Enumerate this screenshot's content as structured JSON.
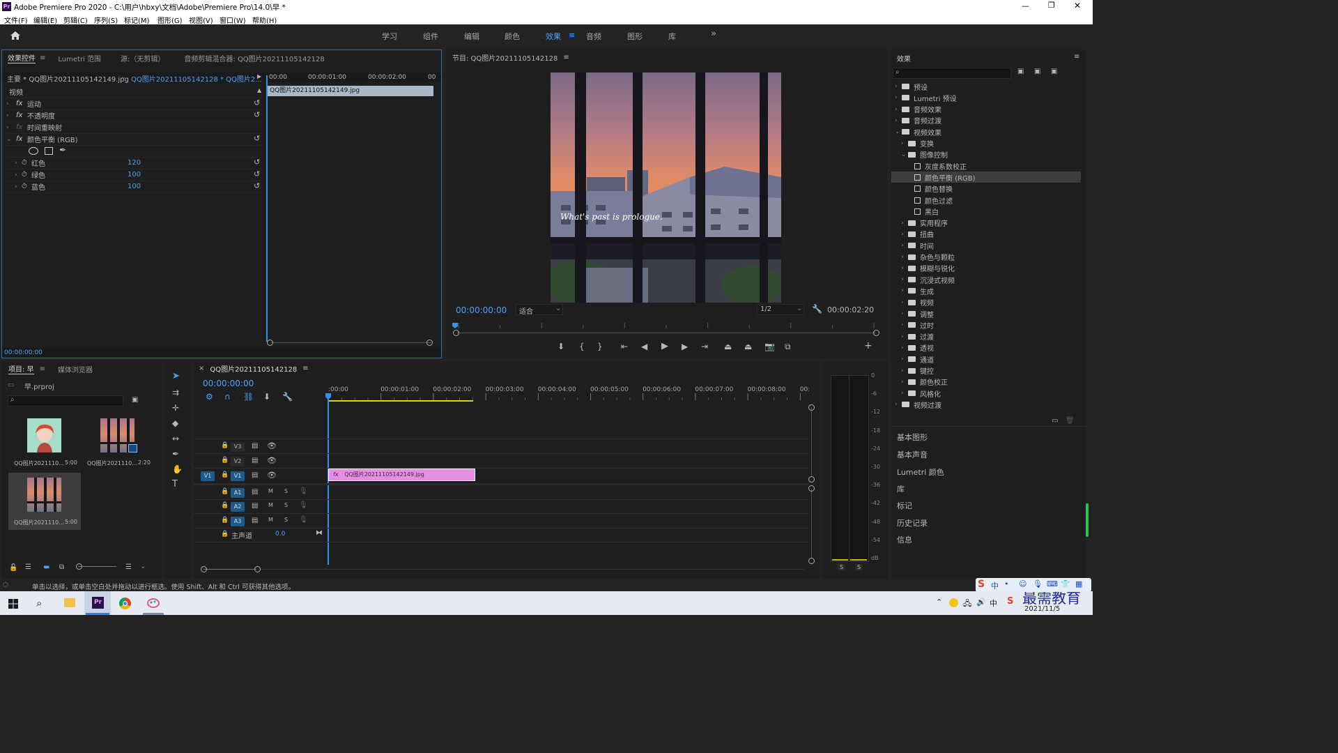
{
  "window": {
    "app_badge": "Pr",
    "title": "Adobe Premiere Pro 2020 - C:\\用户\\hbxy\\文档\\Adobe\\Premiere Pro\\14.0\\早 *",
    "controls": [
      "—",
      "❐",
      "✕"
    ]
  },
  "menu": [
    "文件(F)",
    "编辑(E)",
    "剪辑(C)",
    "序列(S)",
    "标记(M)",
    "图形(G)",
    "视图(V)",
    "窗口(W)",
    "帮助(H)"
  ],
  "workspaces": {
    "items": [
      "学习",
      "组件",
      "编辑",
      "颜色",
      "效果",
      "音频",
      "图形",
      "库"
    ],
    "active": "效果",
    "active_menu_glyph": "≡",
    "more": "»"
  },
  "effect_controls": {
    "tabs": [
      "效果控件",
      "Lumetri 范围",
      "源:（无剪辑）",
      "音频剪辑混合器: QQ图片20211105142128"
    ],
    "tab_menu_glyph": "≡",
    "master_label": "主要 * QQ图片20211105142149.jpg",
    "sequence_label": "QQ图片20211105142128 * QQ图片2...",
    "ruler": [
      "00:00",
      "00:00:01:00",
      "00:00:02:00",
      "00"
    ],
    "clip_name": "QQ图片20211105142149.jpg",
    "section": "视频",
    "fx_label": "fx",
    "effects": [
      {
        "name": "运动"
      },
      {
        "name": "不透明度"
      },
      {
        "name": "时间重映射"
      },
      {
        "name": "颜色平衡 (RGB)"
      }
    ],
    "params": [
      {
        "name": "红色",
        "value": "120"
      },
      {
        "name": "绿色",
        "value": "100"
      },
      {
        "name": "蓝色",
        "value": "100"
      }
    ],
    "timecode": "00:00:00:00"
  },
  "program": {
    "title": "节目: QQ图片20211105142128",
    "menu_glyph": "≡",
    "overlay_text": "What's past is prologue.",
    "timecode": "00:00:00:00",
    "fit": "适合",
    "resolution": "1/2",
    "duration": "00:00:02:20",
    "playhead_fraction": 0.0,
    "controls": [
      "marker",
      "mark-in",
      "mark-out",
      "go-to-in",
      "step-back",
      "play",
      "step-forward",
      "go-to-out",
      "lift",
      "extract",
      "export-frame",
      "compare"
    ],
    "add_glyph": "+"
  },
  "effects_panel": {
    "title": "效果",
    "menu_glyph": "≡",
    "tree": [
      {
        "label": "预设",
        "level": 0,
        "expanded": false,
        "kind": "folder"
      },
      {
        "label": "Lumetri 预设",
        "level": 0,
        "expanded": false,
        "kind": "folder"
      },
      {
        "label": "音频效果",
        "level": 0,
        "expanded": false,
        "kind": "folder"
      },
      {
        "label": "音频过渡",
        "level": 0,
        "expanded": false,
        "kind": "folder"
      },
      {
        "label": "视频效果",
        "level": 0,
        "expanded": true,
        "kind": "folder"
      },
      {
        "label": "变换",
        "level": 1,
        "expanded": false,
        "kind": "folder"
      },
      {
        "label": "图像控制",
        "level": 1,
        "expanded": true,
        "kind": "folder"
      },
      {
        "label": "灰度系数校正",
        "level": 2,
        "kind": "effect"
      },
      {
        "label": "颜色平衡 (RGB)",
        "level": 2,
        "kind": "effect",
        "selected": true
      },
      {
        "label": "颜色替换",
        "level": 2,
        "kind": "effect"
      },
      {
        "label": "颜色过滤",
        "level": 2,
        "kind": "effect"
      },
      {
        "label": "黑白",
        "level": 2,
        "kind": "effect"
      },
      {
        "label": "实用程序",
        "level": 1,
        "expanded": false,
        "kind": "folder"
      },
      {
        "label": "扭曲",
        "level": 1,
        "expanded": false,
        "kind": "folder"
      },
      {
        "label": "时间",
        "level": 1,
        "expanded": false,
        "kind": "folder"
      },
      {
        "label": "杂色与颗粒",
        "level": 1,
        "expanded": false,
        "kind": "folder"
      },
      {
        "label": "模糊与锐化",
        "level": 1,
        "expanded": false,
        "kind": "folder"
      },
      {
        "label": "沉浸式视频",
        "level": 1,
        "expanded": false,
        "kind": "folder"
      },
      {
        "label": "生成",
        "level": 1,
        "expanded": false,
        "kind": "folder"
      },
      {
        "label": "视频",
        "level": 1,
        "expanded": false,
        "kind": "folder"
      },
      {
        "label": "调整",
        "level": 1,
        "expanded": false,
        "kind": "folder"
      },
      {
        "label": "过时",
        "level": 1,
        "expanded": false,
        "kind": "folder"
      },
      {
        "label": "过渡",
        "level": 1,
        "expanded": false,
        "kind": "folder"
      },
      {
        "label": "透视",
        "level": 1,
        "expanded": false,
        "kind": "folder"
      },
      {
        "label": "通道",
        "level": 1,
        "expanded": false,
        "kind": "folder"
      },
      {
        "label": "键控",
        "level": 1,
        "expanded": false,
        "kind": "folder"
      },
      {
        "label": "颜色校正",
        "level": 1,
        "expanded": false,
        "kind": "folder"
      },
      {
        "label": "风格化",
        "level": 1,
        "expanded": false,
        "kind": "folder"
      },
      {
        "label": "视频过渡",
        "level": 0,
        "expanded": false,
        "kind": "folder"
      }
    ],
    "bottom_panels": [
      "基本图形",
      "基本声音",
      "Lumetri 颜色",
      "库",
      "标记",
      "历史记录",
      "信息"
    ]
  },
  "project": {
    "tabs": [
      "项目: 早",
      "媒体浏览器"
    ],
    "tab_menu_glyph": "≡",
    "file": "早.prproj",
    "items": [
      {
        "name": "QQ图片2021110...",
        "duration": "5:00",
        "thumb": "portrait"
      },
      {
        "name": "QQ图片2021110...",
        "duration": "2:20",
        "thumb": "window-seq"
      },
      {
        "name": "QQ图片2021110...",
        "duration": "5:00",
        "thumb": "window",
        "selected": true
      }
    ]
  },
  "timeline": {
    "close_glyph": "×",
    "menu_glyph": "≡",
    "title": "QQ图片20211105142128",
    "timecode": "00:00:00:00",
    "ruler": [
      ":00:00",
      "00:00:01:00",
      "00:00:02:00",
      "00:00:03:00",
      "00:00:04:00",
      "00:00:05:00",
      "00:00:06:00",
      "00:00:07:00",
      "00:00:08:00",
      "00:00:09:"
    ],
    "video_tracks": [
      "V3",
      "V2",
      "V1"
    ],
    "audio_tracks": [
      "A1",
      "A2",
      "A3"
    ],
    "source_patch": "V1",
    "mute_label": "M",
    "solo_label": "S",
    "master_label": "主声道",
    "master_value": "0.0",
    "clip": {
      "name": "QQ图片20211105142149.jpg",
      "fx": "fx",
      "start_seconds": 0,
      "end_seconds": 2.8,
      "color": "#e48fe2"
    }
  },
  "audio_meter": {
    "scale": [
      "0",
      "-6",
      "-12",
      "-18",
      "-24",
      "-30",
      "-36",
      "-42",
      "-48",
      "-54",
      "dB"
    ],
    "solo": [
      "S",
      "S"
    ]
  },
  "status": {
    "text": "单击以选择，或单击空白处并拖动以进行框选。使用 Shift、Alt 和 Ctrl 可获得其他选项。"
  },
  "taskbar": {
    "app_badge": "Pr",
    "date": "2021/11/5",
    "watermark": "最需教育",
    "ime": "中"
  },
  "colors": {
    "accent": "#4ba3ff",
    "clip_pink": "#e48fe2",
    "panel_bg": "#1e1e1e",
    "selection": "#3d3d3d"
  }
}
